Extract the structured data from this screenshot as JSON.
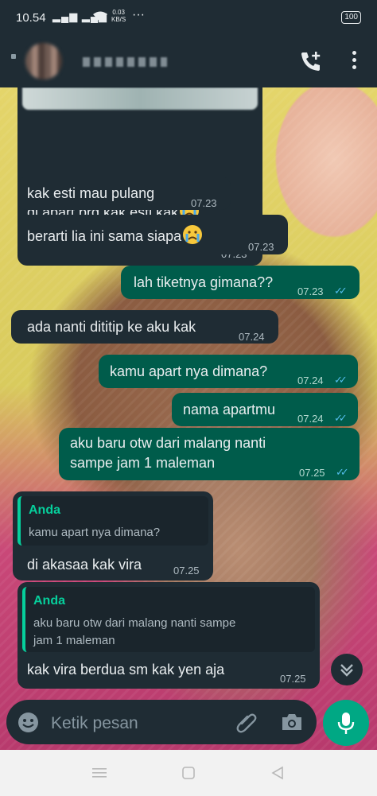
{
  "status_bar": {
    "time": "10.54",
    "signal": "▂▄▆ ▂▄▆",
    "net_speed": "0.03",
    "net_unit": "KB/S",
    "more": "···",
    "battery": "100"
  },
  "header": {
    "call_icon": "add-call-icon",
    "menu_icon": "more-vert-icon"
  },
  "messages": [
    {
      "dir": "in",
      "text": "di apart brg kak esti kak",
      "emoji": "crying-face-emoji",
      "time": "07.23"
    },
    {
      "dir": "in",
      "text": "kak esti mau pulang",
      "time": "07.23"
    },
    {
      "dir": "in",
      "text": "berarti lia ini sama siapa",
      "emoji": "crying-face-emoji",
      "time": "07.23"
    },
    {
      "dir": "out",
      "text": "lah tiketnya gimana??",
      "time": "07.23"
    },
    {
      "dir": "in",
      "text": "ada nanti dititip ke aku kak",
      "time": "07.24"
    },
    {
      "dir": "out",
      "text": "kamu apart nya dimana?",
      "time": "07.24"
    },
    {
      "dir": "out",
      "text": "nama apartmu",
      "time": "07.24"
    },
    {
      "dir": "out",
      "text_line1": "aku baru otw dari malang nanti",
      "text_line2": "sampe jam 1 maleman",
      "time": "07.25"
    },
    {
      "dir": "in",
      "quote_author": "Anda",
      "quote_text": "kamu apart nya dimana?",
      "text": "di akasaa kak vira",
      "time": "07.25"
    },
    {
      "dir": "in",
      "quote_author": "Anda",
      "quote_line1": "aku baru otw dari malang nanti sampe",
      "quote_line2": "jam 1 maleman",
      "text": "kak vira berdua sm kak yen aja",
      "time": "07.25"
    }
  ],
  "composer": {
    "placeholder": "Ketik pesan",
    "emoji_icon": "emoji-icon",
    "attach_icon": "paperclip-icon",
    "camera_icon": "camera-icon",
    "mic_icon": "mic-icon"
  },
  "ticks": "✓✓",
  "colors": {
    "incoming_bubble": "#1f2c34",
    "outgoing_bubble": "#005c4b",
    "accent": "#00a884",
    "read_ticks": "#53bdeb",
    "quote_author": "#06cf9c"
  }
}
